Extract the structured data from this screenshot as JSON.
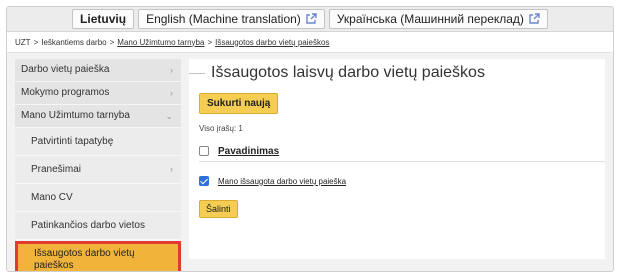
{
  "languages": [
    {
      "label": "Lietuvių",
      "active": true,
      "external": false
    },
    {
      "label": "English (Machine translation)",
      "active": false,
      "external": true
    },
    {
      "label": "Українська (Машинний переклад)",
      "active": false,
      "external": true
    }
  ],
  "breadcrumb": {
    "root": "UZT",
    "sep": ">",
    "items": [
      "Ieškantiems darbo",
      "Mano Užimtumo tarnyba",
      "Išsaugotos darbo vietų paieškos"
    ]
  },
  "sidebar": {
    "items": [
      {
        "label": "Darbo vietų paieška",
        "chevron": "›"
      },
      {
        "label": "Mokymo programos",
        "chevron": "›"
      },
      {
        "label": "Mano Užimtumo tarnyba",
        "chevron": "⌄"
      }
    ],
    "subitems": [
      {
        "label": "Patvirtinti tapatybę",
        "chevron": ""
      },
      {
        "label": "Pranešimai",
        "chevron": "›"
      },
      {
        "label": "Mano CV",
        "chevron": ""
      },
      {
        "label": "Patinkančios darbo vietos",
        "chevron": ""
      }
    ],
    "active": {
      "line1": "Išsaugotos darbo vietų",
      "line2": "paieškos"
    }
  },
  "main": {
    "title": "Išsaugotos laisvų darbo vietų paieškos",
    "create_label": "Sukurti naują",
    "count_text": "Viso įrašų: 1",
    "column_header": "Pavadinimas",
    "rows": [
      {
        "name": "Mano išsaugota darbo vietų paieška",
        "checked": true
      }
    ],
    "delete_label": "Šalinti"
  },
  "colors": {
    "accent": "#f4cd52",
    "active_item": "#f0b43a",
    "highlight_border": "#e13b2e",
    "checkbox": "#2f6fd6"
  }
}
